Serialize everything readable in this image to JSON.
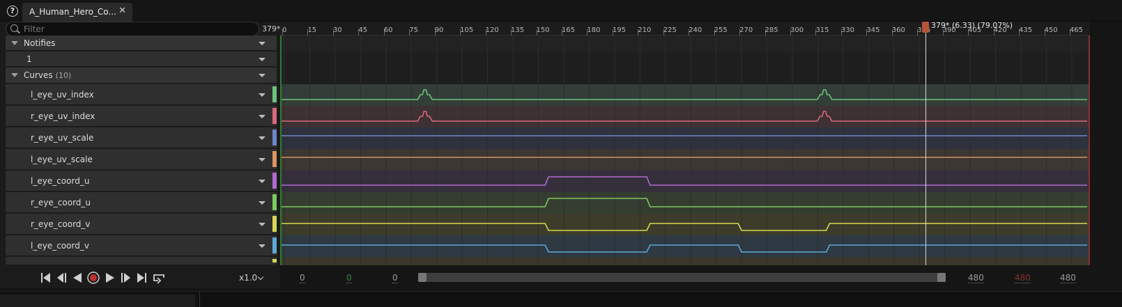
{
  "tab": {
    "title": "A_Human_Hero_Co...",
    "close": "✕",
    "help": "?"
  },
  "filter": {
    "placeholder": "Filter",
    "frame_readout": "379*"
  },
  "tracks": {
    "notifies_label": "Notifies",
    "notify_item": "1",
    "curves_label": "Curves",
    "curves_count": "(10)"
  },
  "curves": [
    {
      "name": "l_eye_uv_index",
      "color": "#6dc27c"
    },
    {
      "name": "r_eye_uv_index",
      "color": "#d86a7a"
    },
    {
      "name": "r_eye_uv_scale",
      "color": "#6f86c9"
    },
    {
      "name": "l_eye_uv_scale",
      "color": "#d89464"
    },
    {
      "name": "l_eye_coord_u",
      "color": "#b06ad0"
    },
    {
      "name": "r_eye_coord_u",
      "color": "#7ec95e"
    },
    {
      "name": "r_eye_coord_v",
      "color": "#d7d655"
    },
    {
      "name": "l_eye_coord_v",
      "color": "#5fa9d6"
    }
  ],
  "transport": {
    "speed": "x1.0",
    "buttons": [
      "to-start-icon",
      "step-back-icon",
      "play-reverse-icon",
      "record-icon",
      "play-icon",
      "step-forward-icon",
      "to-end-icon",
      "loop-icon"
    ]
  },
  "ruler": {
    "ticks": [
      "0",
      "15",
      "30",
      "45",
      "60",
      "75",
      "90",
      "105",
      "120",
      "135",
      "150",
      "165",
      "180",
      "195",
      "210",
      "225",
      "240",
      "255",
      "270",
      "285",
      "300",
      "315",
      "330",
      "345",
      "360",
      "375",
      "390",
      "405",
      "420",
      "435",
      "450",
      "465"
    ],
    "playhead_label": "379* (6.33) (79.07%)",
    "playhead_frame": 379
  },
  "range": {
    "view_start": "0",
    "work_start": "0",
    "play_start": "0",
    "view_end": "480",
    "work_end": "480",
    "play_end": "480",
    "colors": {
      "view": "#9a9a9a",
      "work": "#3f8a3f",
      "play_end": "#8a2f2f"
    }
  }
}
